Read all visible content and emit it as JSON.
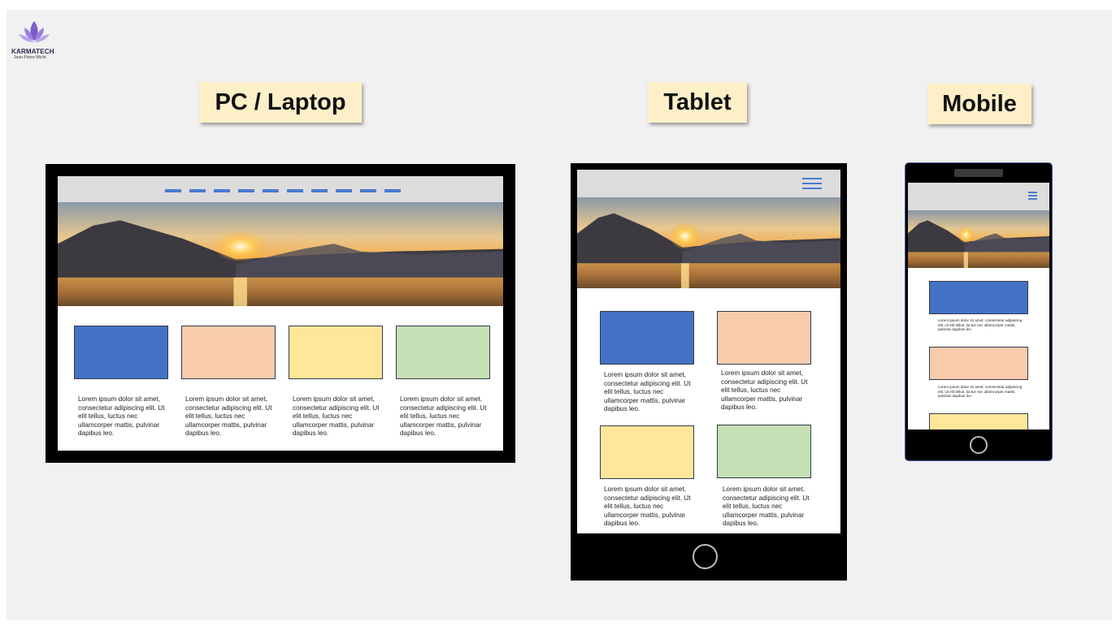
{
  "logo": {
    "name": "KARMATECH",
    "subtitle": "Jean-Pierre Wicht",
    "icon": "lotus-icon"
  },
  "labels": {
    "pc": "PC / Laptop",
    "tablet": "Tablet",
    "mobile": "Mobile"
  },
  "lorem": "Lorem ipsum dolor sit amet, consectetur adipiscing elit. Ut elit tellus, luctus nec ullamcorper mattis, pulvinar dapibus leo.",
  "colors": {
    "blue": "#4472c4",
    "peach": "#f8cbad",
    "yellow": "#ffe699",
    "green": "#c5e0b4",
    "accent": "#4a7bd0"
  }
}
